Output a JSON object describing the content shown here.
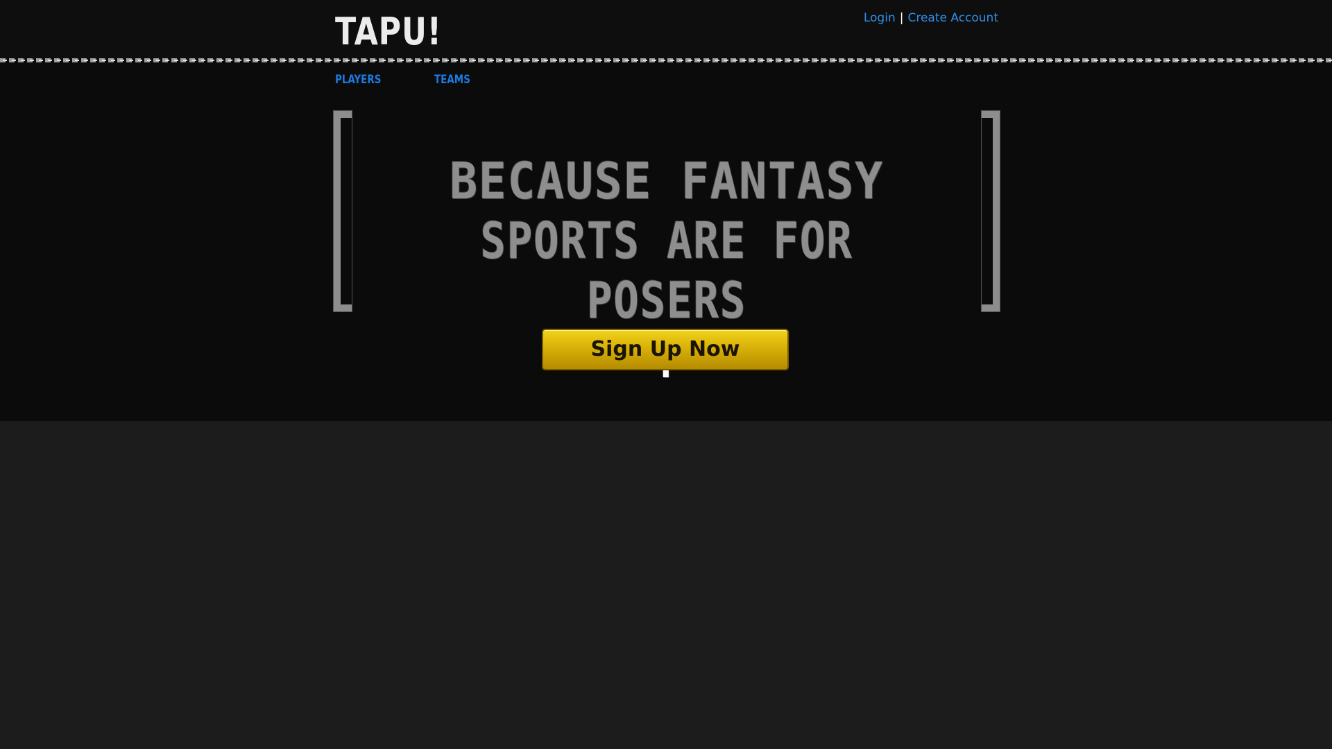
{
  "header": {
    "logo": "TAPU!",
    "login": "Login",
    "separator": "|",
    "create_account": "Create Account"
  },
  "nav": {
    "items": [
      {
        "label": "PLAYERS"
      },
      {
        "label": "TEAMS"
      }
    ]
  },
  "hero": {
    "line1": "BECAUSE FANTASY",
    "line2": "SPORTS ARE FOR POSERS",
    "exclamation": "!",
    "signup_label": "Sign Up Now"
  },
  "colors": {
    "link": "#1c7ae0",
    "signup_gold": "#d8b208",
    "tagline_gray": "#8e8e8e",
    "page_background": "#1c1c1c"
  }
}
